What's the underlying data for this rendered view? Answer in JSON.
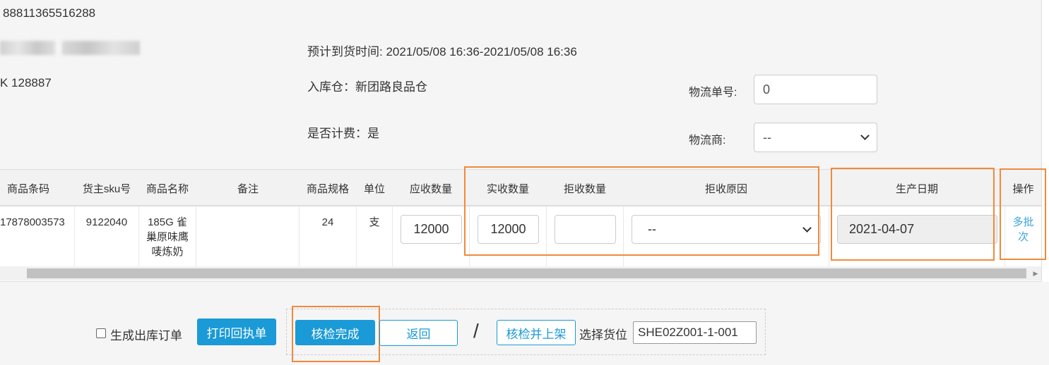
{
  "order": {
    "number_partial": "88811365516288",
    "code_partial": "K 128887",
    "expected_arrival": "预计到货时间: 2021/05/08 16:36-2021/05/08 16:36",
    "warehouse": "入库仓：新团路良品仓",
    "billable": "是否计费：是"
  },
  "logistics": {
    "tracking_label": "物流单号:",
    "tracking_value": "0",
    "carrier_label": "物流商:",
    "carrier_selected": "--"
  },
  "table": {
    "headers": {
      "barcode": "商品条码",
      "owner_sku": "货主sku号",
      "name": "商品名称",
      "remark": "备注",
      "spec": "商品规格",
      "unit": "单位",
      "expected_qty": "应收数量",
      "received_qty": "实收数量",
      "rejected_qty": "拒收数量",
      "reject_reason": "拒收原因",
      "production_date": "生产日期",
      "action": "操作"
    },
    "row": {
      "barcode": "17878003573",
      "owner_sku": "9122040",
      "name_line1": "185G 雀",
      "name_line2": "巢原味鹰",
      "name_line3": "唛炼奶",
      "remark": "",
      "spec": "24",
      "unit": "支",
      "expected_qty": "12000",
      "received_qty": "12000",
      "rejected_qty": "",
      "reject_reason": "--",
      "production_date": "2021-04-07",
      "action_line1": "多批",
      "action_line2": "次"
    }
  },
  "footer": {
    "generate_outbound_label": "生成出库订单",
    "print_receipt": "打印回执单",
    "inspect_complete": "核检完成",
    "back": "返回",
    "separator": "/",
    "inspect_and_shelve": "核检并上架",
    "select_location_label": "选择货位",
    "location_value": "SHE02Z001-1-001"
  },
  "colors": {
    "primary": "#1a9ad6",
    "highlight": "#f08a3c",
    "link": "#3aa3d8"
  }
}
